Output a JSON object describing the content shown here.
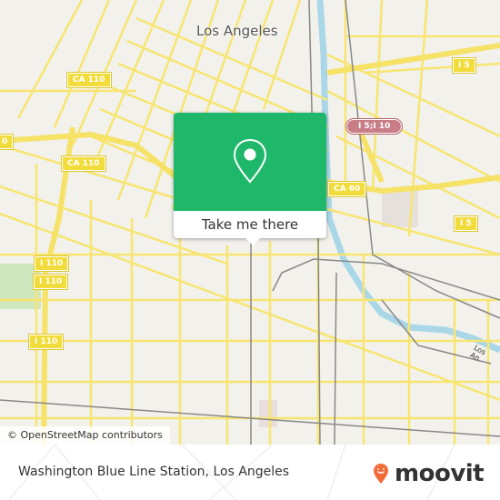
{
  "map": {
    "city_label": "Los Angeles",
    "river_label": "Los An",
    "attribution": "© OpenStreetMap contributors",
    "shields": [
      {
        "id": "ca110-top",
        "label": "CA 110",
        "type": "state"
      },
      {
        "id": "ca110-mid",
        "label": "CA 110",
        "type": "state"
      },
      {
        "id": "ca110-left",
        "label": "0",
        "type": "state"
      },
      {
        "id": "i110-a",
        "label": "I 110",
        "type": "state"
      },
      {
        "id": "i110-b",
        "label": "I 110",
        "type": "state"
      },
      {
        "id": "i110-c",
        "label": "I 110",
        "type": "state"
      },
      {
        "id": "i5-top",
        "label": "I 5",
        "type": "state"
      },
      {
        "id": "i5i10",
        "label": "I 5;I 10",
        "type": "interstate"
      },
      {
        "id": "ca60",
        "label": "CA 60",
        "type": "state"
      },
      {
        "id": "i5-right",
        "label": "I 5",
        "type": "state"
      }
    ],
    "colors": {
      "background": "#f2f1ec",
      "road": "#f7e570",
      "rail": "#888888",
      "river": "#a9d7e8",
      "park": "#cfe7bf"
    }
  },
  "popup": {
    "icon": "location-pin-icon",
    "button_label": "Take me there",
    "color": "#1fb86a"
  },
  "footer": {
    "title": "Washington Blue Line Station, Los Angeles",
    "logo_text": "moovit",
    "logo_color": "#f26c3b"
  }
}
